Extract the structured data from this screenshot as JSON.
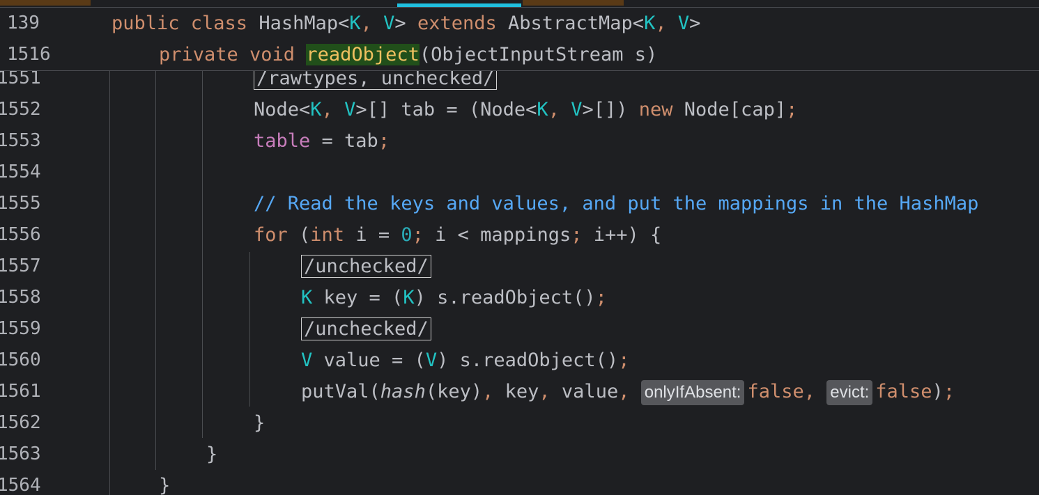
{
  "sticky": [
    {
      "ln": "139",
      "tokens": [
        {
          "t": "public class ",
          "c": "kw"
        },
        {
          "t": "HashMap<",
          "c": "str"
        },
        {
          "t": "K",
          "c": "tp"
        },
        {
          "t": ", ",
          "c": "semi"
        },
        {
          "t": "V",
          "c": "tp"
        },
        {
          "t": "> ",
          "c": "str"
        },
        {
          "t": "extends ",
          "c": "kw"
        },
        {
          "t": "AbstractMap<",
          "c": "str"
        },
        {
          "t": "K",
          "c": "tp"
        },
        {
          "t": ", ",
          "c": "semi"
        },
        {
          "t": "V",
          "c": "tp"
        },
        {
          "t": ">",
          "c": "str"
        }
      ]
    },
    {
      "ln": "1516",
      "tokens": [
        {
          "t": "private void ",
          "c": "kw"
        },
        {
          "t": "readObject",
          "c": "hl"
        },
        {
          "t": "(ObjectInputStream s)",
          "c": "str"
        }
      ]
    }
  ],
  "lines": [
    {
      "ln": "1551",
      "tokens": [
        {
          "t": "/rawtypes, unchecked/",
          "c": "box"
        }
      ]
    },
    {
      "ln": "1552",
      "tokens": [
        {
          "t": "Node<",
          "c": "str"
        },
        {
          "t": "K",
          "c": "tp"
        },
        {
          "t": ", ",
          "c": "semi"
        },
        {
          "t": "V",
          "c": "tp"
        },
        {
          "t": ">[] tab = (Node<",
          "c": "str"
        },
        {
          "t": "K",
          "c": "tp"
        },
        {
          "t": ", ",
          "c": "semi"
        },
        {
          "t": "V",
          "c": "tp"
        },
        {
          "t": ">[]) ",
          "c": "str"
        },
        {
          "t": "new ",
          "c": "kw"
        },
        {
          "t": "Node[cap]",
          "c": "str"
        },
        {
          "t": ";",
          "c": "semi"
        }
      ]
    },
    {
      "ln": "1553",
      "tokens": [
        {
          "t": "table",
          "c": "fld"
        },
        {
          "t": " = tab",
          "c": "str"
        },
        {
          "t": ";",
          "c": "semi"
        }
      ]
    },
    {
      "ln": "1554",
      "tokens": []
    },
    {
      "ln": "1555",
      "tokens": [
        {
          "t": "// Read the keys and values, and put the mappings in the HashMap",
          "c": "cmt"
        }
      ]
    },
    {
      "ln": "1556",
      "tokens": [
        {
          "t": "for ",
          "c": "kw"
        },
        {
          "t": "(",
          "c": "str"
        },
        {
          "t": "int ",
          "c": "kw"
        },
        {
          "t": "i = ",
          "c": "str"
        },
        {
          "t": "0",
          "c": "num"
        },
        {
          "t": "; ",
          "c": "semi"
        },
        {
          "t": "i < mappings",
          "c": "str"
        },
        {
          "t": "; ",
          "c": "semi"
        },
        {
          "t": "i++) {",
          "c": "str"
        }
      ]
    },
    {
      "ln": "1557",
      "tokens": [
        {
          "t": "/unchecked/",
          "c": "box"
        }
      ]
    },
    {
      "ln": "1558",
      "tokens": [
        {
          "t": "K ",
          "c": "tp"
        },
        {
          "t": "key = (",
          "c": "str"
        },
        {
          "t": "K",
          "c": "tp"
        },
        {
          "t": ") s.readObject()",
          "c": "str"
        },
        {
          "t": ";",
          "c": "semi"
        }
      ]
    },
    {
      "ln": "1559",
      "tokens": [
        {
          "t": "/unchecked/",
          "c": "box"
        }
      ]
    },
    {
      "ln": "1560",
      "tokens": [
        {
          "t": "V ",
          "c": "tp"
        },
        {
          "t": "value = (",
          "c": "str"
        },
        {
          "t": "V",
          "c": "tp"
        },
        {
          "t": ") s.readObject()",
          "c": "str"
        },
        {
          "t": ";",
          "c": "semi"
        }
      ]
    },
    {
      "ln": "1561",
      "tokens": [
        {
          "t": "putVal(",
          "c": "str"
        },
        {
          "t": "hash",
          "c": "ital"
        },
        {
          "t": "(key)",
          "c": "str"
        },
        {
          "t": ", ",
          "c": "semi"
        },
        {
          "t": "key",
          "c": "str"
        },
        {
          "t": ", ",
          "c": "semi"
        },
        {
          "t": "value",
          "c": "str"
        },
        {
          "t": ", ",
          "c": "semi"
        },
        {
          "t": "onlyIfAbsent:",
          "c": "hint"
        },
        {
          "t": "false",
          "c": "kw"
        },
        {
          "t": ", ",
          "c": "semi"
        },
        {
          "t": "evict:",
          "c": "hint"
        },
        {
          "t": "false",
          "c": "kw"
        },
        {
          "t": ")",
          "c": "str"
        },
        {
          "t": ";",
          "c": "semi"
        }
      ]
    },
    {
      "ln": "1562",
      "tokens": [
        {
          "t": "}",
          "c": "str"
        }
      ]
    },
    {
      "ln": "1563",
      "tokens": [
        {
          "t": "}",
          "c": "str"
        }
      ]
    },
    {
      "ln": "1564",
      "tokens": [
        {
          "t": "}",
          "c": "str"
        }
      ]
    }
  ]
}
